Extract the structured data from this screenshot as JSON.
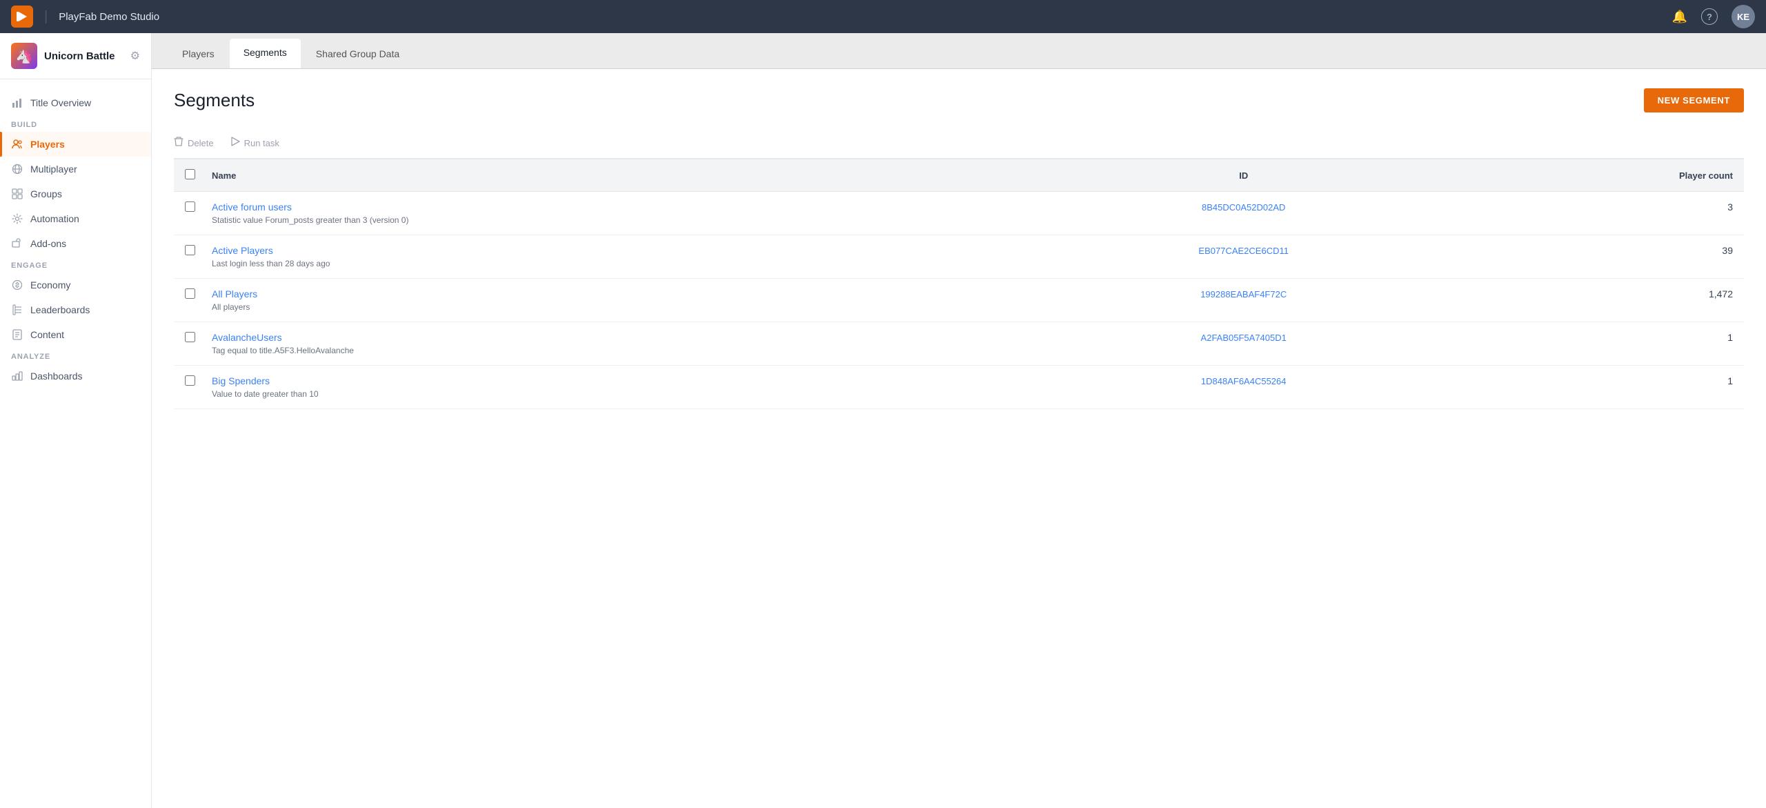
{
  "topnav": {
    "logo_text": "▶",
    "studio_name": "PlayFab Demo Studio",
    "divider": "|",
    "bell_icon": "🔔",
    "help_icon": "?",
    "avatar_initials": "KE"
  },
  "sidebar": {
    "brand_name": "Unicorn Battle",
    "brand_emoji": "🦄",
    "gear_icon": "⚙",
    "sections": [
      {
        "items": [
          {
            "id": "title-overview",
            "label": "Title Overview",
            "icon": "📊"
          }
        ]
      },
      {
        "label": "BUILD",
        "items": [
          {
            "id": "players",
            "label": "Players",
            "icon": "👥",
            "active": true
          },
          {
            "id": "multiplayer",
            "label": "Multiplayer",
            "icon": "🌐"
          },
          {
            "id": "groups",
            "label": "Groups",
            "icon": "🗂"
          },
          {
            "id": "automation",
            "label": "Automation",
            "icon": "🤖"
          },
          {
            "id": "add-ons",
            "label": "Add-ons",
            "icon": "🔧"
          }
        ]
      },
      {
        "label": "ENGAGE",
        "items": [
          {
            "id": "economy",
            "label": "Economy",
            "icon": "💰"
          },
          {
            "id": "leaderboards",
            "label": "Leaderboards",
            "icon": "🏆"
          },
          {
            "id": "content",
            "label": "Content",
            "icon": "📄"
          }
        ]
      },
      {
        "label": "ANALYZE",
        "items": [
          {
            "id": "dashboards",
            "label": "Dashboards",
            "icon": "📈"
          }
        ]
      }
    ]
  },
  "tabs": [
    {
      "id": "players",
      "label": "Players",
      "active": false
    },
    {
      "id": "segments",
      "label": "Segments",
      "active": true
    },
    {
      "id": "shared-group-data",
      "label": "Shared Group Data",
      "active": false
    }
  ],
  "page": {
    "title": "Segments",
    "new_segment_btn": "NEW SEGMENT"
  },
  "toolbar": {
    "delete_label": "Delete",
    "run_task_label": "Run task"
  },
  "table": {
    "columns": [
      {
        "id": "checkbox",
        "label": ""
      },
      {
        "id": "name",
        "label": "Name"
      },
      {
        "id": "id",
        "label": "ID"
      },
      {
        "id": "count",
        "label": "Player count"
      }
    ],
    "rows": [
      {
        "name": "Active forum users",
        "description": "Statistic value Forum_posts greater than 3 (version 0)",
        "id": "8B45DC0A52D02AD",
        "player_count": "3"
      },
      {
        "name": "Active Players",
        "description": "Last login less than 28 days ago",
        "id": "EB077CAE2CE6CD11",
        "player_count": "39"
      },
      {
        "name": "All Players",
        "description": "All players",
        "id": "199288EABAF4F72C",
        "player_count": "1,472"
      },
      {
        "name": "AvalancheUsers",
        "description": "Tag equal to title.A5F3.HelloAvalanche",
        "id": "A2FAB05F5A7405D1",
        "player_count": "1"
      },
      {
        "name": "Big Spenders",
        "description": "Value to date greater than 10",
        "id": "1D848AF6A4C55264",
        "player_count": "1"
      }
    ]
  }
}
